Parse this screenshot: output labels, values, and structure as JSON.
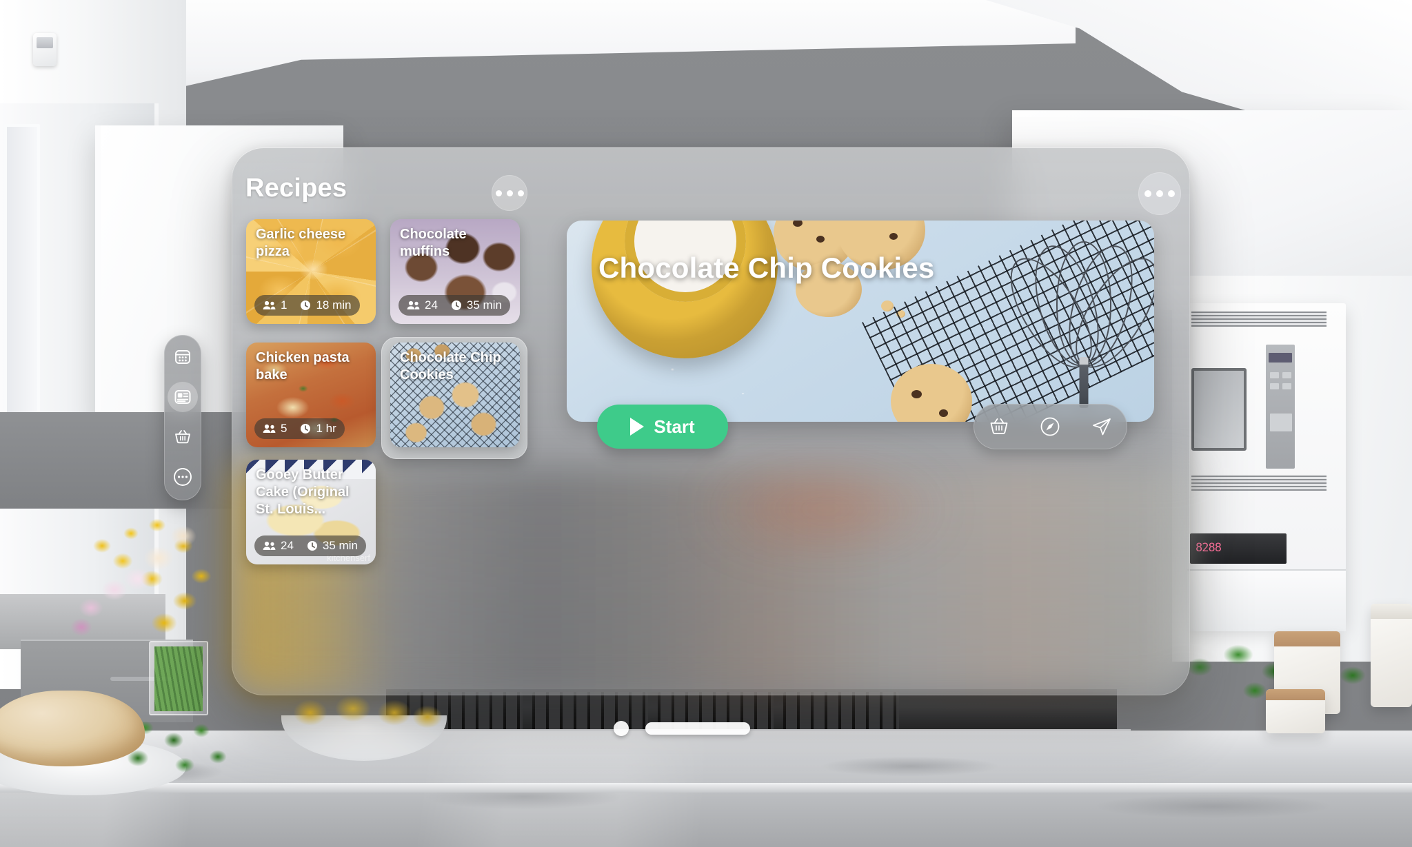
{
  "app": {
    "window_title": "Recipes",
    "header_more_icon": "ellipsis-icon",
    "ornament_more_icon": "ellipsis-icon"
  },
  "sidebar": {
    "items": [
      {
        "icon": "collections-grid-icon",
        "name": "collections",
        "selected": false
      },
      {
        "icon": "recipe-card-icon",
        "name": "recipes",
        "selected": true
      },
      {
        "icon": "basket-icon",
        "name": "groceries",
        "selected": false
      },
      {
        "icon": "ellipsis-circle-icon",
        "name": "more",
        "selected": false
      }
    ]
  },
  "recipe_list": [
    {
      "title": "Garlic cheese pizza",
      "servings": "1",
      "time": "18 min",
      "selected": false,
      "photo": "pizza",
      "servings_icon": "people-icon",
      "time_icon": "clock-icon"
    },
    {
      "title": "Chocolate muffins",
      "servings": "24",
      "time": "35 min",
      "selected": false,
      "photo": "muffins",
      "servings_icon": "people-icon",
      "time_icon": "clock-icon"
    },
    {
      "title": "Chicken pasta bake",
      "servings": "5",
      "time": "1 hr",
      "selected": false,
      "photo": "pasta",
      "servings_icon": "people-icon",
      "time_icon": "clock-icon"
    },
    {
      "title": "Chocolate Chip Cookies",
      "servings": "",
      "time": "",
      "selected": true,
      "photo": "cookies",
      "servings_icon": "",
      "time_icon": ""
    },
    {
      "title": "Gooey Butter Cake (Original St. Louis...",
      "servings": "24",
      "time": "35 min",
      "selected": false,
      "photo": "cake",
      "watermark": "kitchenserf",
      "servings_icon": "people-icon",
      "time_icon": "clock-icon"
    }
  ],
  "detail": {
    "title": "Chocolate Chip Cookies",
    "hero_photo": "chocolate-chip-cookies-hero",
    "start_button": {
      "label": "Start",
      "icon": "play-icon",
      "color": "#3ECB8A"
    },
    "actions": [
      {
        "icon": "basket-icon",
        "name": "add-to-groceries"
      },
      {
        "icon": "compass-icon",
        "name": "open-in-browser"
      },
      {
        "icon": "share-icon",
        "name": "share"
      }
    ]
  },
  "window_chrome": {
    "close_icon": "close-dot",
    "resize_handle": "resize-bar"
  },
  "colors": {
    "accent_green": "#3ECB8A",
    "window_glass": "#ABADAE",
    "text_primary": "#FFFFFF",
    "meta_pill": "#3C3834"
  }
}
